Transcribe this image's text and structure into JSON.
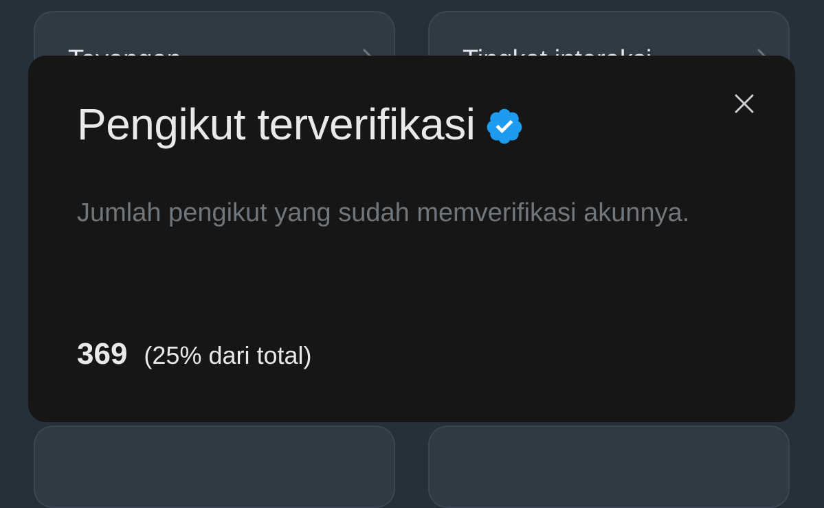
{
  "background_cards": {
    "top_left_label": "Tayangan",
    "top_right_label": "Tingkat interaksi"
  },
  "modal": {
    "title": "Pengikut terverifikasi",
    "description": "Jumlah pengikut yang sudah memverifikasi akunnya.",
    "stat_value": "369",
    "stat_share": "(25% dari total)",
    "icons": {
      "verified": "verified-badge-icon",
      "close": "close-icon"
    }
  },
  "colors": {
    "page_bg": "#26303a",
    "modal_bg": "#161616",
    "verified_blue": "#1d9bf0",
    "primary_text": "#e7e9ea",
    "secondary_text": "#71767b"
  }
}
